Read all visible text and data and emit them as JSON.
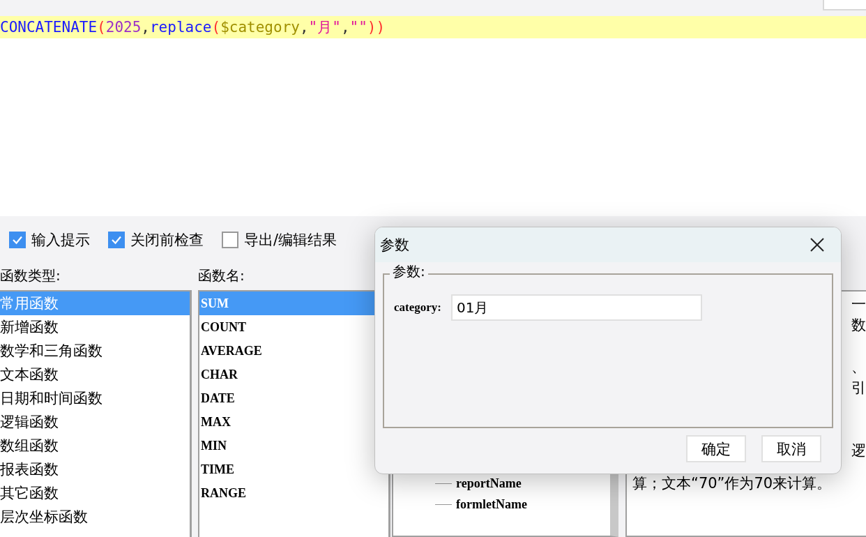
{
  "editor": {
    "code_tokens": [
      {
        "kind": "function",
        "text": "CONCATENATE"
      },
      {
        "kind": "paren",
        "text": "("
      },
      {
        "kind": "number",
        "text": "2025"
      },
      {
        "kind": "punct",
        "text": ","
      },
      {
        "kind": "function",
        "text": "replace"
      },
      {
        "kind": "paren",
        "text": "("
      },
      {
        "kind": "variable",
        "text": "$category"
      },
      {
        "kind": "punct",
        "text": ","
      },
      {
        "kind": "string",
        "text": "\"月\""
      },
      {
        "kind": "punct",
        "text": ","
      },
      {
        "kind": "string",
        "text": "\"\""
      },
      {
        "kind": "paren",
        "text": "))"
      }
    ]
  },
  "options": [
    {
      "label": "输入提示",
      "checked": true
    },
    {
      "label": "关闭前检查",
      "checked": true
    },
    {
      "label": "导出/编辑结果",
      "checked": false
    }
  ],
  "function_types": {
    "label": "函数类型:",
    "items": [
      {
        "text": "常用函数",
        "selected": true
      },
      {
        "text": "新增函数",
        "selected": false
      },
      {
        "text": "数学和三角函数",
        "selected": false
      },
      {
        "text": "文本函数",
        "selected": false
      },
      {
        "text": "日期和时间函数",
        "selected": false
      },
      {
        "text": "逻辑函数",
        "selected": false
      },
      {
        "text": "数组函数",
        "selected": false
      },
      {
        "text": "报表函数",
        "selected": false
      },
      {
        "text": "其它函数",
        "selected": false
      },
      {
        "text": "层次坐标函数",
        "selected": false
      }
    ]
  },
  "function_names": {
    "label": "函数名:",
    "items": [
      {
        "text": "SUM",
        "selected": true
      },
      {
        "text": "COUNT",
        "selected": false
      },
      {
        "text": "AVERAGE",
        "selected": false
      },
      {
        "text": "CHAR",
        "selected": false
      },
      {
        "text": "DATE",
        "selected": false
      },
      {
        "text": "MAX",
        "selected": false
      },
      {
        "text": "MIN",
        "selected": false
      },
      {
        "text": "TIME",
        "selected": false
      },
      {
        "text": "RANGE",
        "selected": false
      }
    ]
  },
  "variable_tree": {
    "items": [
      "reportName",
      "formletName"
    ]
  },
  "description": {
    "lines": [
      {
        "kind": "covered",
        "text": "一"
      },
      {
        "kind": "covered",
        "text": "数"
      },
      {
        "kind": "blank"
      },
      {
        "kind": "covered",
        "text": "、"
      },
      {
        "kind": "covered",
        "text": "引"
      },
      {
        "kind": "blank"
      },
      {
        "kind": "blank"
      },
      {
        "kind": "covered",
        "text": "逻"
      },
      {
        "kind": "full",
        "text": "算；文本“70”作为70来计算。"
      }
    ]
  },
  "dialog": {
    "title": "参数",
    "group_label": "参数:",
    "param_label": "category:",
    "param_value": "01月",
    "buttons": [
      "确定",
      "取消"
    ]
  }
}
